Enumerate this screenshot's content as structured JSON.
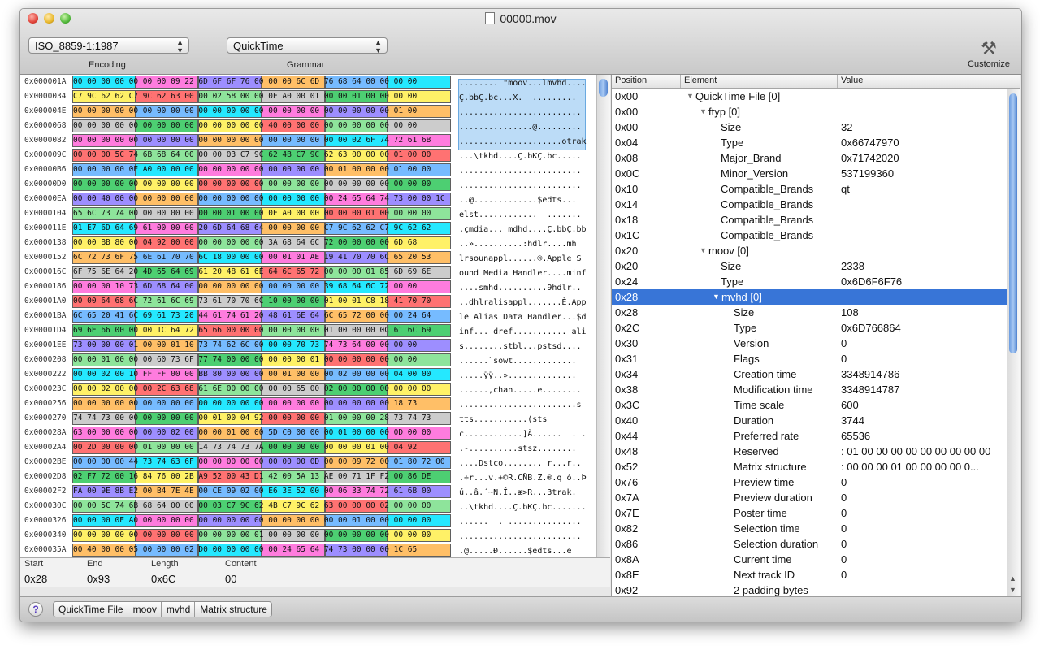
{
  "window": {
    "title": "00000.mov"
  },
  "toolbar": {
    "encoding_value": "ISO_8859-1:1987",
    "encoding_label": "Encoding",
    "grammar_value": "QuickTime",
    "grammar_label": "Grammar",
    "customize_label": "Customize"
  },
  "hex_rows": [
    {
      "addr": "0x000001A",
      "hex": "00 00 00 00 00 00 00 09 22 6D 6F 6F 76 00 00 00 6C 6D 76 68 64 00 00 00 00",
      "ascii": "........ \"moov...lmvhd...."
    },
    {
      "addr": "0x0000034",
      "hex": "C7 9C 62 62 C7 9C 62 63 00 00 02 58 00 00 0E A0 00 01 00 00 01 00 00 00 00",
      "ascii": "Ç.bbÇ.bc...X.  ......... "
    },
    {
      "addr": "0x000004E",
      "hex": "00 00 00 00 00 00 00 00 00 00 00 00 00 00 00 00 00 00 00 00 00 00 00 01 00",
      "ascii": "........................."
    },
    {
      "addr": "0x0000068",
      "hex": "00 00 00 00 00 00 00 00 00 00 00 00 00 00 40 00 00 00 00 00 00 00 00 00 00",
      "ascii": "...............@........."
    },
    {
      "addr": "0x0000082",
      "hex": "00 00 00 00 00 00 00 00 00 00 00 00 00 00 00 00 00 00 00 00 02 6F 74 72 61 6B",
      "ascii": ".....................otrak"
    },
    {
      "addr": "0x000009C",
      "hex": "00 00 00 5C 74 6B 68 64 00 00 00 03 C7 9C 62 4B C7 9C 62 63 00 00 00 01 00 00",
      "ascii": "...\\tkhd....Ç.bKÇ.bc....."
    },
    {
      "addr": "0x00000B6",
      "hex": "00 00 00 00 0E A0 00 00 00 00 00 00 00 00 00 00 00 00 00 01 00 00 00 01 00 00",
      "ascii": "........................."
    },
    {
      "addr": "0x00000D0",
      "hex": "00 00 00 00 00 00 00 00 00 00 00 00 00 00 00 00 00 00 00 00 00 00 00 00 00 00",
      "ascii": "........................."
    },
    {
      "addr": "0x00000EA",
      "hex": "00 00 40 00 00 00 00 00 00 00 00 00 00 00 00 00 00 00 00 24 65 64 74 73 00 00 1C",
      "ascii": "..@.............$edts..."
    },
    {
      "addr": "0x0000104",
      "hex": "65 6C 73 74 00 00 00 00 00 00 00 01 00 00 0E A0 00 00 00 00 00 01 00 00 00 00",
      "ascii": "elst............  ....... "
    },
    {
      "addr": "0x000011E",
      "hex": "01 E7 6D 64 69 61 00 00 00 20 6D 64 68 64 00 00 00 00 C7 9C 62 62 C7 9C 62 62",
      "ascii": ".çmdia... mdhd....Ç.bbÇ.bb"
    },
    {
      "addr": "0x0000138",
      "hex": "00 00 BB 80 00 04 92 00 00 00 00 00 00 00 3A 68 64 6C 72 00 00 00 00 6D 68",
      "ascii": "..»..........:hdlr....mh"
    },
    {
      "addr": "0x0000152",
      "hex": "6C 72 73 6F 75 6E 61 70 70 6C 18 00 00 00 00 01 01 AE 19 41 70 70 6C 65 20 53",
      "ascii": "lrsounappl......®.Apple S"
    },
    {
      "addr": "0x000016C",
      "hex": "6F 75 6E 64 20 4D 65 64 69 61 20 48 61 6E 64 6C 65 72 00 00 00 01 85 6D 69 6E",
      "ascii": "ound Media Handler....minf"
    },
    {
      "addr": "0x0000186",
      "hex": "00 00 00 10 73 6D 68 64 00 00 00 00 00 00 00 00 00 00 39 68 64 6C 72 00 00",
      "ascii": "....smhd..........9hdlr.."
    },
    {
      "addr": "0x00001A0",
      "hex": "00 00 64 68 6C 72 61 6C 69 73 61 70 70 6C 10 00 00 00 01 00 01 C8 18 41 70 70",
      "ascii": "..dhlralisappl.......È.App"
    },
    {
      "addr": "0x00001BA",
      "hex": "6C 65 20 41 6C 69 61 73 20 44 61 74 61 20 48 61 6E 64 6C 65 72 00 00 00 24 64",
      "ascii": "le Alias Data Handler...$d"
    },
    {
      "addr": "0x00001D4",
      "hex": "69 6E 66 00 00 00 1C 64 72 65 66 00 00 00 00 00 00 00 01 00 00 00 0C 61 6C 69",
      "ascii": "inf... dref........... ali"
    },
    {
      "addr": "0x00001EE",
      "hex": "73 00 00 00 01 00 00 01 10 73 74 62 6C 00 00 00 70 73 74 73 64 00 00 00 00",
      "ascii": "s........stbl...pstsd...."
    },
    {
      "addr": "0x0000208",
      "hex": "00 00 01 00 00 00 60 73 6F 77 74 00 00 00 00 00 00 01 00 00 00 00 00 00 00",
      "ascii": "......`sowt............."
    },
    {
      "addr": "0x0000222",
      "hex": "00 00 02 00 10 FF FF 00 00 BB 80 00 00 00 00 01 00 00 00 02 00 00 00 04 00 00",
      "ascii": ".....ÿÿ..».............."
    },
    {
      "addr": "0x000023C",
      "hex": "00 00 02 00 00 00 2C 63 68 61 6E 00 00 00 00 00 65 00 02 00 00 00 00 00 00 00",
      "ascii": "......,chan.....e........"
    },
    {
      "addr": "0x0000256",
      "hex": "00 00 00 00 00 00 00 00 00 00 00 00 00 00 00 00 00 00 00 00 00 00 00 18 73",
      "ascii": "........................s"
    },
    {
      "addr": "0x0000270",
      "hex": "74 74 73 00 00 00 00 00 00 00 01 00 04 92 00 00 00 00 01 00 00 00 28 73 74 73",
      "ascii": "tts...........(sts"
    },
    {
      "addr": "0x000028A",
      "hex": "63 00 00 00 00 00 00 02 00 00 00 01 00 00 5D C0 00 00 00 01 00 00 00 0D 00 00",
      "ascii": "c............]À......  . ."
    },
    {
      "addr": "0x00002A4",
      "hex": "00 2D 00 00 00 01 00 00 00 14 73 74 73 7A 00 00 00 00 00 00 00 01 00 04 92",
      "ascii": ".-..........stsz........"
    },
    {
      "addr": "0x00002BE",
      "hex": "00 00 00 00 44 73 74 63 6F 00 00 00 00 00 00 00 00 0D 00 00 09 72 00 01 80 72 00",
      "ascii": "....Dstco........ r...r.."
    },
    {
      "addr": "0x00002D8",
      "hex": "02 F7 72 00 16 84 76 00 2B A9 52 00 43 D1 42 00 5A 13 AE 00 71 1F F2 00 86 DE",
      "ascii": ".÷r...v.+©R.CÑB.Z.®.q ò..Þ"
    },
    {
      "addr": "0x00002F2",
      "hex": "FA 00 9E 8B E2 00 B4 7E 4E 00 CE 09 02 00 E6 3E 52 00 00 06 33 74 72 61 6B 00",
      "ascii": "ú..â.´~N.Î..æ>R...3trak."
    },
    {
      "addr": "0x000030C",
      "hex": "00 00 5C 74 6B 68 64 00 00 00 03 C7 9C 62 4B C7 9C 62 63 00 00 00 02 00 00 00",
      "ascii": "..\\tkhd....Ç.bKÇ.bc......."
    },
    {
      "addr": "0x0000326",
      "hex": "00 00 00 0E A0 00 00 00 00 00 00 00 00 00 00 00 00 00 00 00 01 00 00 00 00 00",
      "ascii": "......  . ..............."
    },
    {
      "addr": "0x0000340",
      "hex": "00 00 00 00 00 00 00 00 00 00 00 00 00 01 00 00 00 00 00 00 00 00 00 00 00 00",
      "ascii": "........................."
    },
    {
      "addr": "0x000035A",
      "hex": "00 40 00 00 05 00 00 00 02 D0 00 00 00 00 00 24 65 64 74 73 00 00 00 1C 65",
      "ascii": ".@.....Ð......$edts...e"
    }
  ],
  "selection_info": {
    "headers": {
      "start": "Start",
      "end": "End",
      "length": "Length",
      "content": "Content"
    },
    "values": {
      "start": "0x28",
      "end": "0x93",
      "length": "0x6C",
      "content": "00"
    }
  },
  "outline": {
    "headers": {
      "position": "Position",
      "element": "Element",
      "value": "Value"
    },
    "rows": [
      {
        "pos": "0x00",
        "el": "QuickTime File [0]",
        "val": "",
        "level": 0,
        "tri": "▼"
      },
      {
        "pos": "0x00",
        "el": "ftyp [0]",
        "val": "",
        "level": 1,
        "tri": "▼"
      },
      {
        "pos": "0x00",
        "el": "Size",
        "val": "32",
        "level": 2,
        "tri": ""
      },
      {
        "pos": "0x04",
        "el": "Type",
        "val": "0x66747970",
        "level": 2,
        "tri": ""
      },
      {
        "pos": "0x08",
        "el": "Major_Brand",
        "val": "0x71742020",
        "level": 2,
        "tri": ""
      },
      {
        "pos": "0x0C",
        "el": "Minor_Version",
        "val": "537199360",
        "level": 2,
        "tri": ""
      },
      {
        "pos": "0x10",
        "el": "Compatible_Brands",
        "val": "qt",
        "level": 2,
        "tri": ""
      },
      {
        "pos": "0x14",
        "el": "Compatible_Brands",
        "val": "",
        "level": 2,
        "tri": ""
      },
      {
        "pos": "0x18",
        "el": "Compatible_Brands",
        "val": "",
        "level": 2,
        "tri": ""
      },
      {
        "pos": "0x1C",
        "el": "Compatible_Brands",
        "val": "",
        "level": 2,
        "tri": ""
      },
      {
        "pos": "0x20",
        "el": "moov [0]",
        "val": "",
        "level": 1,
        "tri": "▼"
      },
      {
        "pos": "0x20",
        "el": "Size",
        "val": "2338",
        "level": 2,
        "tri": ""
      },
      {
        "pos": "0x24",
        "el": "Type",
        "val": "0x6D6F6F76",
        "level": 2,
        "tri": ""
      },
      {
        "pos": "0x28",
        "el": "mvhd [0]",
        "val": "",
        "level": 2,
        "tri": "▼",
        "selected": true
      },
      {
        "pos": "0x28",
        "el": "Size",
        "val": "108",
        "level": 3,
        "tri": ""
      },
      {
        "pos": "0x2C",
        "el": "Type",
        "val": "0x6D766864",
        "level": 3,
        "tri": ""
      },
      {
        "pos": "0x30",
        "el": "Version",
        "val": "0",
        "level": 3,
        "tri": ""
      },
      {
        "pos": "0x31",
        "el": "Flags",
        "val": "0",
        "level": 3,
        "tri": ""
      },
      {
        "pos": "0x34",
        "el": "Creation time",
        "val": "3348914786",
        "level": 3,
        "tri": ""
      },
      {
        "pos": "0x38",
        "el": "Modification time",
        "val": "3348914787",
        "level": 3,
        "tri": ""
      },
      {
        "pos": "0x3C",
        "el": "Time scale",
        "val": "600",
        "level": 3,
        "tri": ""
      },
      {
        "pos": "0x40",
        "el": "Duration",
        "val": "3744",
        "level": 3,
        "tri": ""
      },
      {
        "pos": "0x44",
        "el": "Preferred rate",
        "val": "65536",
        "level": 3,
        "tri": ""
      },
      {
        "pos": "0x48",
        "el": "Reserved",
        "val": ": 01 00 00 00 00 00 00 00 00 00",
        "level": 3,
        "tri": ""
      },
      {
        "pos": "0x52",
        "el": "Matrix structure",
        "val": ": 00 00 00 01 00 00 00 00 0...",
        "level": 3,
        "tri": ""
      },
      {
        "pos": "0x76",
        "el": "Preview time",
        "val": "0",
        "level": 3,
        "tri": ""
      },
      {
        "pos": "0x7A",
        "el": "Preview duration",
        "val": "0",
        "level": 3,
        "tri": ""
      },
      {
        "pos": "0x7E",
        "el": "Poster time",
        "val": "0",
        "level": 3,
        "tri": ""
      },
      {
        "pos": "0x82",
        "el": "Selection time",
        "val": "0",
        "level": 3,
        "tri": ""
      },
      {
        "pos": "0x86",
        "el": "Selection duration",
        "val": "0",
        "level": 3,
        "tri": ""
      },
      {
        "pos": "0x8A",
        "el": "Current time",
        "val": "0",
        "level": 3,
        "tri": ""
      },
      {
        "pos": "0x8E",
        "el": "Next track ID",
        "val": "0",
        "level": 3,
        "tri": ""
      },
      {
        "pos": "0x92",
        "el": "2 padding bytes",
        "val": "",
        "level": 3,
        "tri": ""
      }
    ]
  },
  "breadcrumb": [
    "QuickTime File",
    "moov",
    "mvhd",
    "Matrix structure"
  ],
  "help_label": "?",
  "colors": {
    "selection": "#3875d7",
    "hex_cyan": "#00e5ff",
    "hex_green": "#2fc75a",
    "hex_magenta": "#ff66d9"
  }
}
